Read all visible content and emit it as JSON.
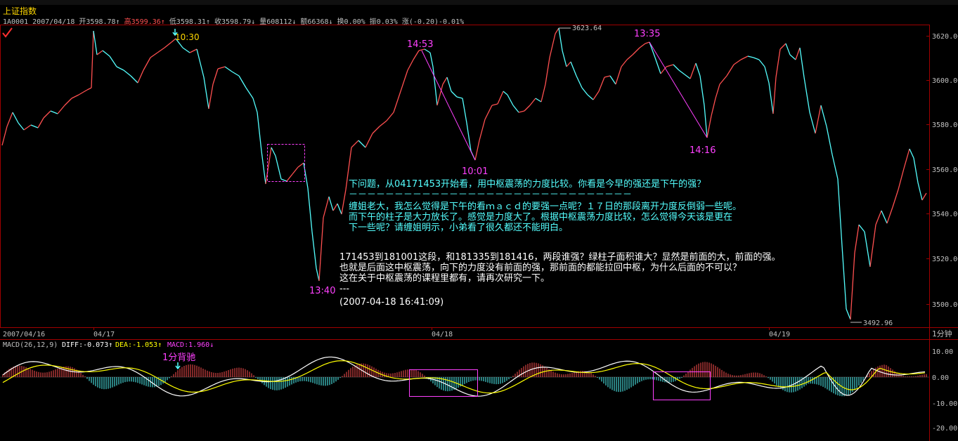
{
  "window": {
    "title": "上证指数",
    "code": "1A0001",
    "date": "2007/04/18"
  },
  "quote": {
    "open": "开3598.78↑",
    "high": "高3599.36↑",
    "low": "低3598.31↑",
    "close": "收3598.79↓",
    "volume": "量608112↓",
    "amount": "额66368↓",
    "turnover": "换0.00%",
    "amplitude": "振0.03%",
    "change": "涨(-0.20)-0.01%"
  },
  "price_axis": {
    "ticks": [
      "3620.00",
      "3600.00",
      "3580.00",
      "3560.00",
      "3540.00",
      "3520.00",
      "3500.00"
    ]
  },
  "date_axis": {
    "labels": [
      "2007/04/16",
      "04/17",
      "04/18",
      "04/19"
    ],
    "period": "1分钟"
  },
  "chart_annotations": {
    "high_label": "3623.64",
    "low_label": "3492.96",
    "times": [
      "10:30",
      "14:53",
      "10:01",
      "13:35",
      "14:16",
      "13:40"
    ]
  },
  "macd": {
    "params": "MACD(26,12,9)",
    "diff": "DIFF:-0.073↑",
    "dea": "DEA:-1.053↑",
    "macd": "MACD:1.960↓",
    "ticks": [
      "10.00",
      "0.00",
      "-10.00",
      "-20.00"
    ],
    "note": "1分背驰"
  },
  "notes": {
    "question": "下问题，从04171453开始看，用中枢震荡的力度比较。你看是今早的强还是下午的强？",
    "dashes": "－－－－－－－－－－－－－－－－－－－－－－－－－－－－－－－",
    "reply1": "缠姐老大，我怎么觉得是下午的看ｍａｃｄ的要强一点呢？１７日的那段离开力度反倒弱一些呢。",
    "reply2": "而下午的柱子是大力放长了。感觉是力度大了。根据中枢震荡力度比较，怎么觉得今天该是更在",
    "reply3": "下一些呢？请缠姐明示，小弟看了很久都还不能明白。",
    "answer1": "171453到181001这段，和181335到181416，两段谁强？绿柱子面积谁大？显然是前面的大，前面的强。",
    "answer2": "也就是后面这中枢震荡，向下的力度没有前面的强，那前面的都能拉回中枢，为什么后面的不可以？",
    "answer3": "这在关于中枢震荡的课程里都有，请再次研究一下。",
    "sep": "---",
    "timestamp": "(2007-04-18 16:41:09)"
  },
  "colors": {
    "up": "#ff5050",
    "down": "#54ffff",
    "marker": "#ff40ff",
    "dif": "#ffffff",
    "dea": "#ffff00",
    "grid": "#a00000"
  }
}
